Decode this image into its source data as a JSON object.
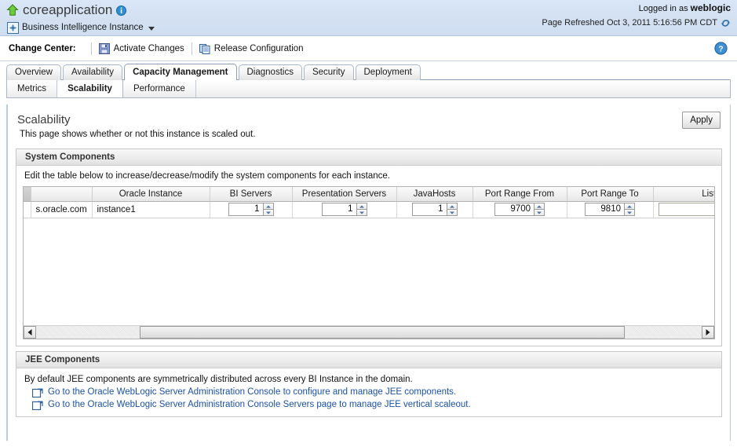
{
  "banner": {
    "home_icon": "home-up-arrow-icon",
    "app_title": "coreapplication",
    "info_icon": "info-icon",
    "instance_icon": "bi-instance-target-icon",
    "instance_label": "Business Intelligence Instance",
    "instance_caret": "chevron-down-icon",
    "logged_in_prefix": "Logged in as",
    "logged_in_user": "weblogic",
    "page_refreshed": "Page Refreshed Oct 3, 2011 5:16:56 PM CDT",
    "refresh_icon": "refresh-icon"
  },
  "change_center": {
    "label": "Change Center:",
    "activate_changes": "Activate Changes",
    "activate_icon": "save-disk-icon",
    "release_configuration": "Release Configuration",
    "release_icon": "copy-pages-icon",
    "help_icon": "help-question-icon"
  },
  "tabs": {
    "primary": [
      {
        "label": "Overview",
        "active": false
      },
      {
        "label": "Availability",
        "active": false
      },
      {
        "label": "Capacity Management",
        "active": true
      },
      {
        "label": "Diagnostics",
        "active": false
      },
      {
        "label": "Security",
        "active": false
      },
      {
        "label": "Deployment",
        "active": false
      }
    ],
    "secondary": [
      {
        "label": "Metrics",
        "active": false
      },
      {
        "label": "Scalability",
        "active": true
      },
      {
        "label": "Performance",
        "active": false
      }
    ]
  },
  "page": {
    "title": "Scalability",
    "subtitle": "This page shows whether or not this instance is scaled out.",
    "apply_label": "Apply"
  },
  "system_components": {
    "heading": "System Components",
    "description": "Edit the table below to increase/decrease/modify the system components for each instance.",
    "columns": [
      "",
      "",
      "Oracle Instance",
      "BI Servers",
      "Presentation Servers",
      "JavaHosts",
      "Port Range From",
      "Port Range To",
      "Listen Address"
    ],
    "row": {
      "host": "s.oracle.com",
      "oracle_instance": "instance1",
      "bi_servers": "1",
      "presentation_servers": "1",
      "java_hosts": "1",
      "port_range_from": "9700",
      "port_range_to": "9810",
      "listen_address": ""
    },
    "scroll_left_icon": "scroll-left-arrow-icon",
    "scroll_right_icon": "scroll-right-arrow-icon"
  },
  "jee_components": {
    "heading": "JEE Components",
    "description": "By default JEE components are symmetrically distributed across every BI Instance in the domain.",
    "links": [
      "Go to the Oracle WebLogic Server Administration Console to configure and manage JEE components.",
      "Go to the Oracle WebLogic Server Administration Console Servers page to manage JEE vertical scaleout."
    ],
    "link_icon": "external-link-icon"
  },
  "colors": {
    "banner_bg": "#d6e4f5",
    "link": "#1b51a8",
    "accent_border": "#b9cce0",
    "home_icon_green": "#4caf2a",
    "info_blue": "#1f78c8"
  }
}
